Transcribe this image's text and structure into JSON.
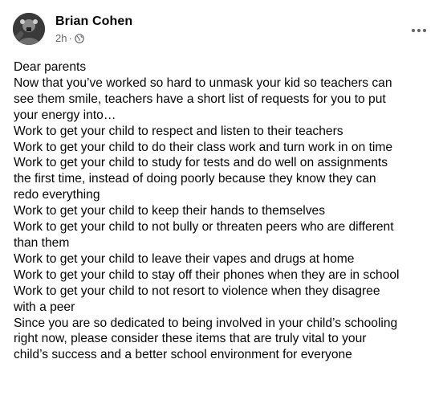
{
  "post": {
    "author": "Brian Cohen",
    "timestamp": "2h",
    "separator": "·",
    "privacy_icon": "globe-icon",
    "menu_icon": "more-options-icon",
    "lines": [
      "Dear parents",
      "Now that you’ve worked so hard to unmask your kid so teachers can",
      "see them smile, teachers have a short list of requests for you to put",
      "your energy into…",
      "Work to get your child to respect and listen to their teachers",
      "Work to get your child to do their class work and turn work in on time",
      "Work to get your child to study for tests and do well on assignments",
      "the first time, instead of doing poorly because they know they can",
      "redo everything",
      "Work to get your child to keep their hands to themselves",
      "Work to get your child to not bully or threaten peers who are different",
      "than them",
      "Work to get your child to leave their vapes and drugs at home",
      "Work to get your child to stay off their phones when they are in school",
      "Work to get your child to not resort to violence when they disagree",
      "with a peer",
      "Since you are so dedicated to being involved in your child’s schooling",
      "right now, please consider these items that are truly vital to your",
      "child’s success and a better school environment for everyone"
    ]
  },
  "colors": {
    "text": "#050505",
    "secondary_text": "#65676b",
    "background": "#ffffff"
  }
}
